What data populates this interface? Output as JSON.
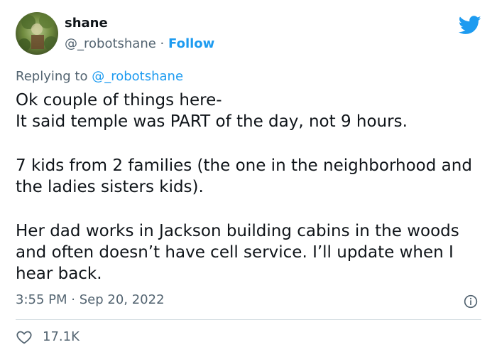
{
  "author": {
    "name": "shane",
    "handle": "@_robotshane",
    "separator": "·",
    "follow_label": "Follow"
  },
  "reply": {
    "prefix": "Replying to",
    "mention": "@_robotshane"
  },
  "tweet": {
    "lines": [
      "Ok couple of things here-",
      "It said temple was PART of the day, not 9 hours.",
      "7 kids from 2 families (the one in the neighborhood and the ladies sisters kids).",
      "Her dad works in Jackson building cabins in the woods and often doesn’t have cell service. I’ll update when I hear back."
    ]
  },
  "meta": {
    "time": "3:55 PM",
    "separator": "·",
    "date": "Sep 20, 2022"
  },
  "engagement": {
    "likes": "17.1K"
  },
  "icons": {
    "bird": "twitter-bird-icon",
    "info": "info-icon",
    "heart": "heart-icon"
  },
  "colors": {
    "brand": "#1d9bf0",
    "text": "#0f1419",
    "secondary": "#536471",
    "divider": "#cfd9de"
  }
}
